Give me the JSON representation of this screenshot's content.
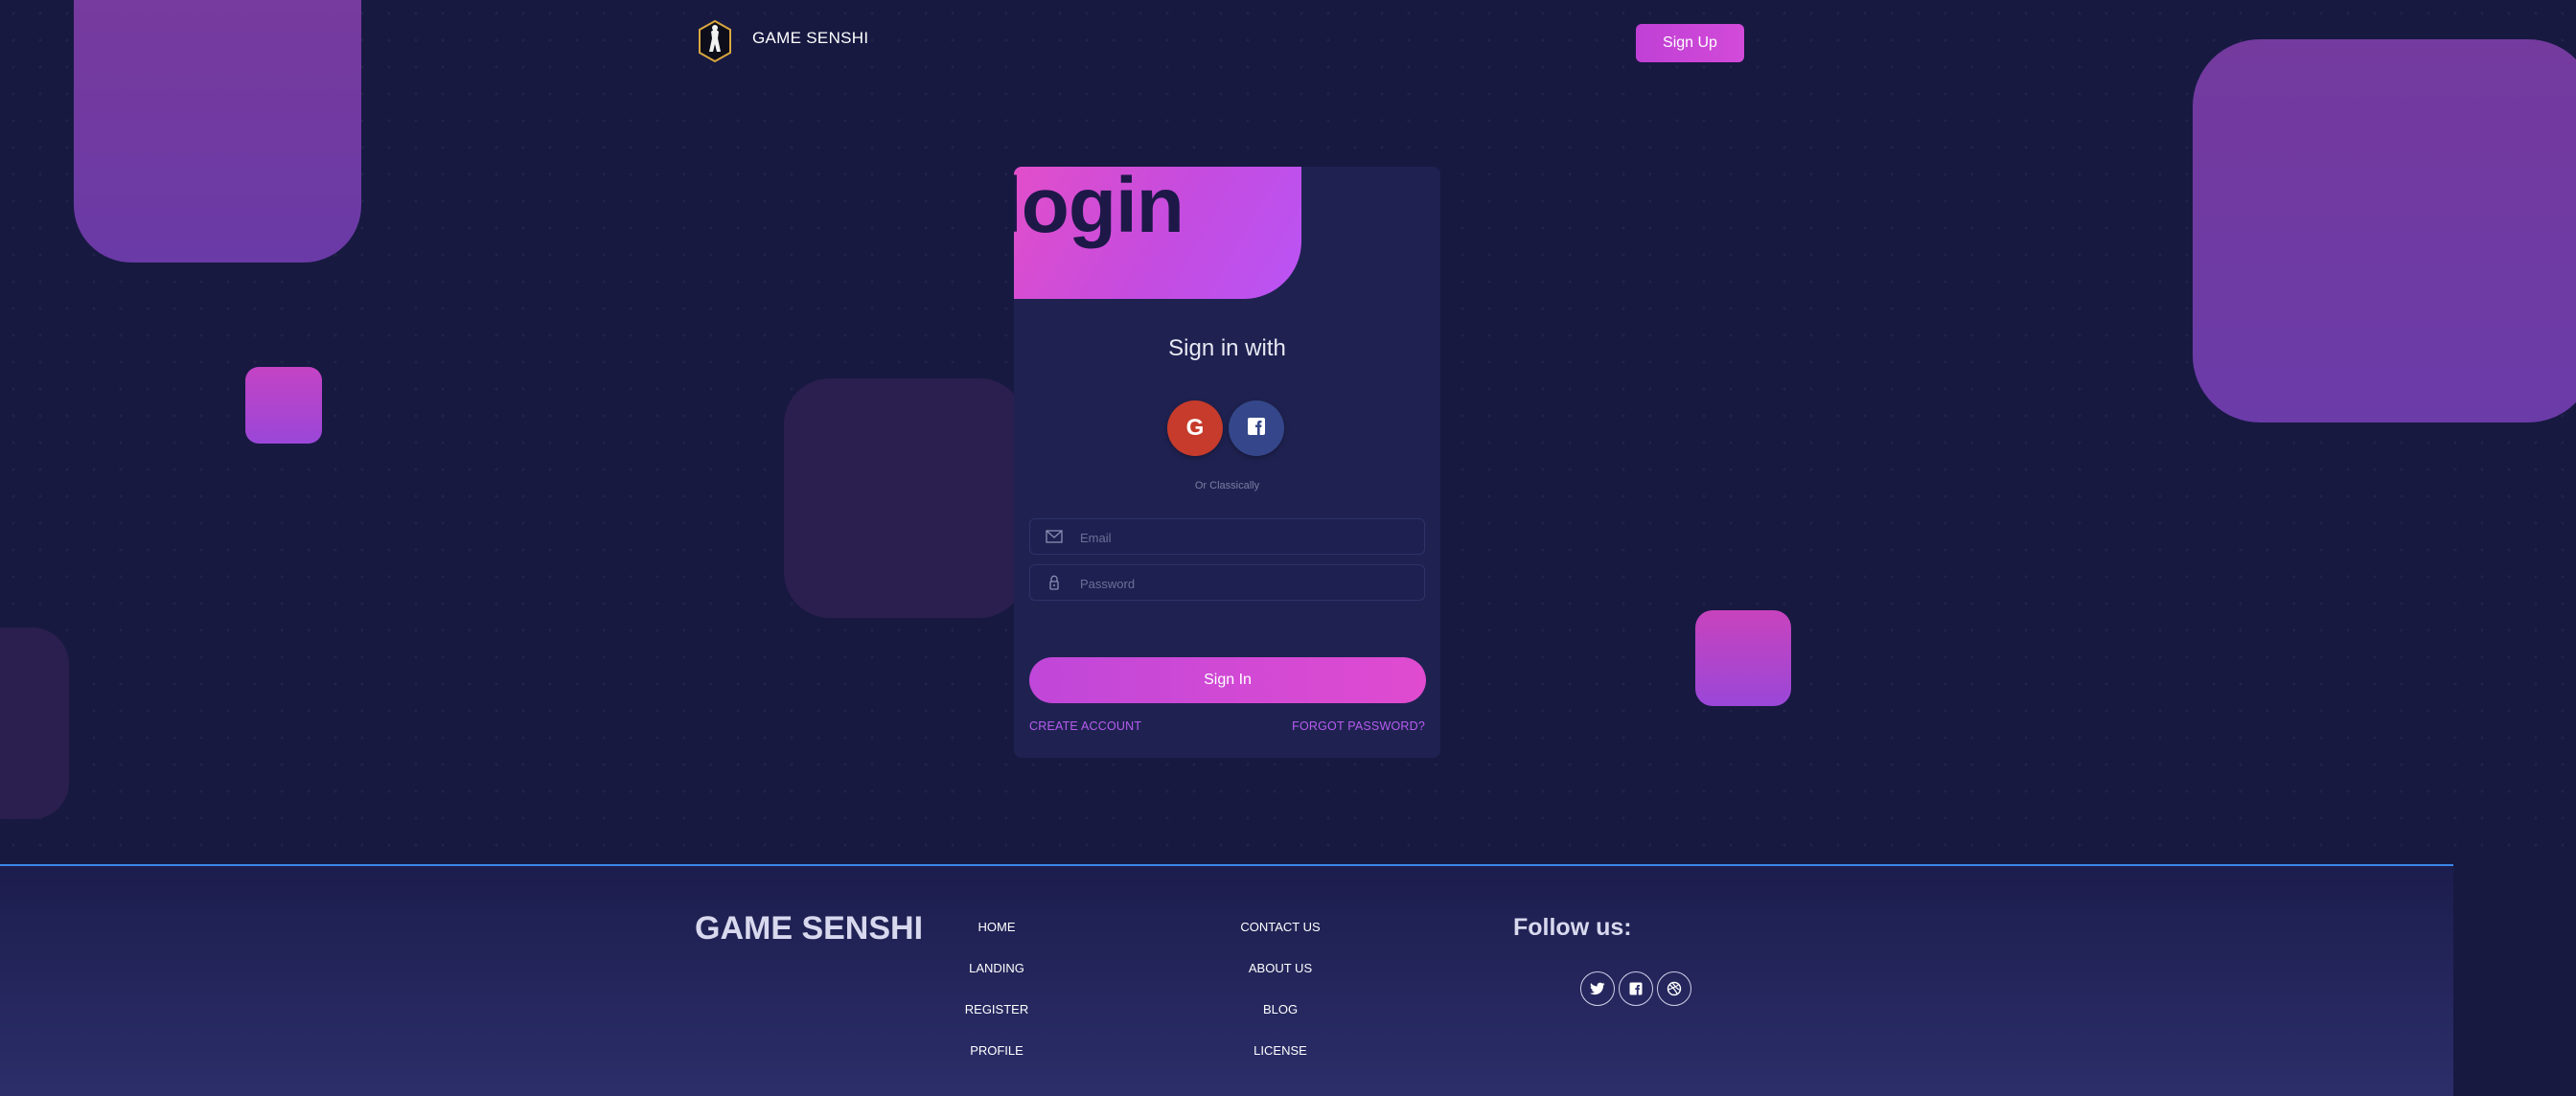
{
  "navbar": {
    "brand": "GAME SENSHI",
    "signup_label": "Sign Up",
    "logo_icon": "ninja-logo-icon"
  },
  "login_card": {
    "title": "login",
    "signin_with": "Sign in with",
    "social": [
      {
        "name": "google",
        "icon": "google-icon",
        "glyph": "G",
        "color": "#c63b2b"
      },
      {
        "name": "facebook",
        "icon": "facebook-icon",
        "color": "#35478a"
      }
    ],
    "or_text": "Or Classically",
    "email_placeholder": "Email",
    "password_placeholder": "Password",
    "signin_label": "Sign In",
    "create_account": "CREATE ACCOUNT",
    "forgot_password": "FORGOT PASSWORD?"
  },
  "footer": {
    "brand": "GAME SENSHI",
    "column1": [
      "HOME",
      "LANDING",
      "REGISTER",
      "PROFILE"
    ],
    "column2": [
      "CONTACT US",
      "ABOUT US",
      "BLOG",
      "LICENSE"
    ],
    "follow_title": "Follow us:",
    "social_icons": [
      "twitter-icon",
      "facebook-icon",
      "dribbble-icon"
    ]
  },
  "colors": {
    "background": "#171941",
    "accent": "#c847d8",
    "link": "#b85cf0"
  }
}
